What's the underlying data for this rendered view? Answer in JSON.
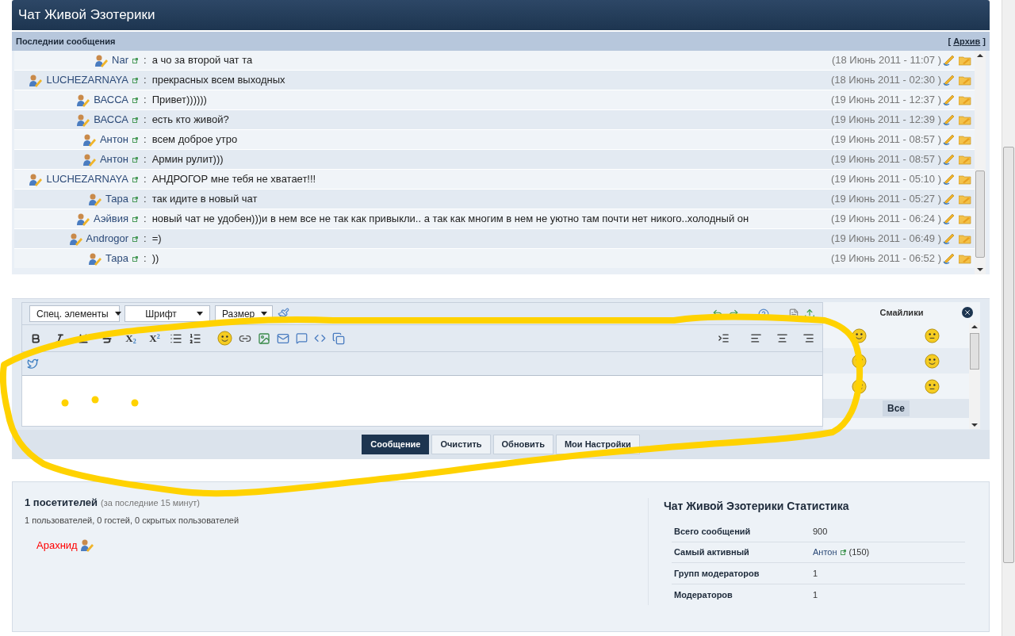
{
  "title": "Чат Живой Эзотерики",
  "messages_header": {
    "title": "Последнии сообщения",
    "archive": {
      "open": "[",
      "label": "Архив",
      "close": "]"
    }
  },
  "separator": ":",
  "messages": [
    {
      "author": "Nar",
      "text": "а чо за второй чат та",
      "time": "(18 Июнь 2011 - 11:07 )"
    },
    {
      "author": "LUCHEZARNAYA",
      "text": "прекрасных всем выходных",
      "time": "(18 Июнь 2011 - 02:30 )"
    },
    {
      "author": "ВАССА",
      "text": "Привет))))))",
      "time": "(19 Июнь 2011 - 12:37 )"
    },
    {
      "author": "ВАССА",
      "text": "есть кто живой?",
      "time": "(19 Июнь 2011 - 12:39 )"
    },
    {
      "author": "Антон",
      "text": "всем доброе утро",
      "time": "(19 Июнь 2011 - 08:57 )"
    },
    {
      "author": "Антон",
      "text": "Армин рулит)))",
      "time": "(19 Июнь 2011 - 08:57 )"
    },
    {
      "author": "LUCHEZARNAYA",
      "text": "АНДРОГОР мне тебя не хватает!!!",
      "time": "(19 Июнь 2011 - 05:10 )"
    },
    {
      "author": "Тара",
      "text": "так идите в новый чат",
      "time": "(19 Июнь 2011 - 05:27 )"
    },
    {
      "author": "Аэйвия",
      "text": "новый чат не удобен)))и в нем все не так как привыкли.. а так как многим в нем не уютно там почти нет никого..холодный он",
      "time": "(19 Июнь 2011 - 06:24 )"
    },
    {
      "author": "Androgor",
      "text": "=)",
      "time": "(19 Июнь 2011 - 06:49 )"
    },
    {
      "author": "Тара",
      "text": "))",
      "time": "(19 Июнь 2011 - 06:52 )"
    }
  ],
  "editor": {
    "selects": [
      "Спец. элементы",
      "Шрифт",
      "Размер"
    ],
    "format_buttons": [
      {
        "kind": "bold"
      },
      {
        "kind": "italic"
      },
      {
        "kind": "underline"
      },
      {
        "kind": "strike"
      }
    ],
    "script_buttons": [
      {
        "label": "X",
        "index": "2",
        "kind": "sub"
      },
      {
        "label": "X",
        "index": "2",
        "kind": "sup"
      }
    ]
  },
  "smilies": {
    "title": "Смайлики",
    "all_button": "Все"
  },
  "actions": [
    {
      "label": "Сообщение",
      "selected": true
    },
    {
      "label": "Очистить",
      "selected": false
    },
    {
      "label": "Обновить",
      "selected": false
    },
    {
      "label": "Мои Настройки",
      "selected": false
    }
  ],
  "online": {
    "count": "1 посетителей",
    "period": "(за последние 15 минут)",
    "breakdown": "1 пользователей, 0 гостей, 0 скрытых пользователей",
    "users": [
      "Арахнид"
    ]
  },
  "stats": {
    "title": "Чат Живой Эзотерики Статистика",
    "rows": [
      {
        "label": "Всего сообщений",
        "value": "900",
        "kind": "text"
      },
      {
        "label": "Самый активный",
        "value": "Антон",
        "extra": "(150)",
        "kind": "user"
      },
      {
        "label": "Групп модераторов",
        "value": "1",
        "kind": "text"
      },
      {
        "label": "Модераторов",
        "value": "1",
        "kind": "text"
      }
    ]
  }
}
